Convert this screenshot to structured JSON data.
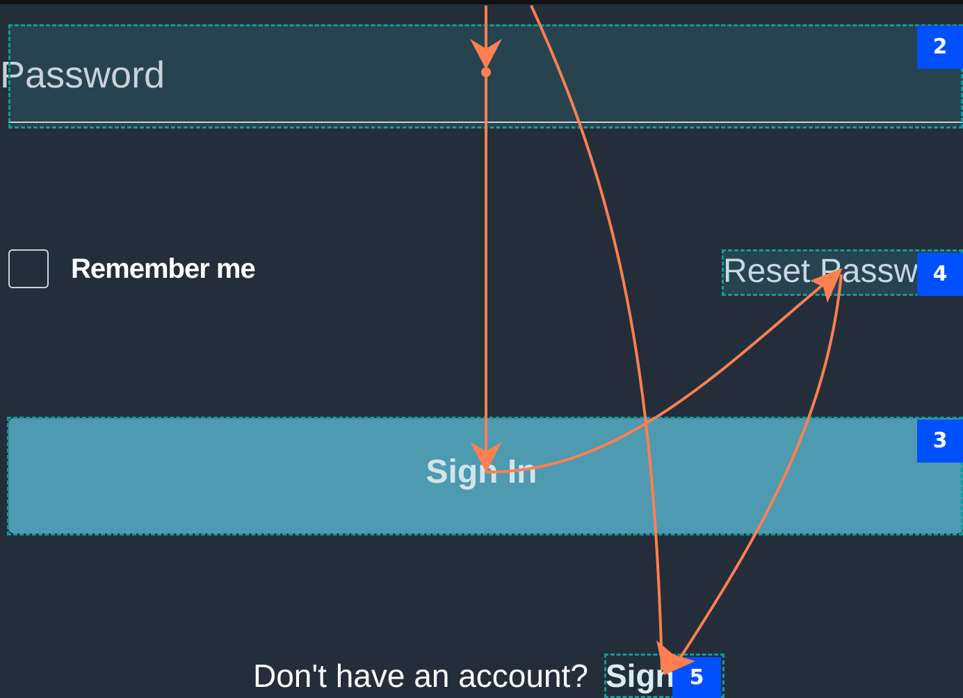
{
  "form": {
    "password": {
      "placeholder": "Password",
      "badge": "2"
    },
    "remember": {
      "label": "Remember me",
      "checked": false
    },
    "reset": {
      "label": "Reset Password",
      "badge": "4"
    },
    "signin": {
      "label": "Sign In",
      "badge": "3"
    },
    "signup": {
      "prompt": "Don't have an account?",
      "label": "Sign Up",
      "badge": "5"
    }
  },
  "colors": {
    "background": "#232e3a",
    "field_background": "#27434f",
    "button_background": "#4d9ab1",
    "badge": "#0050ff",
    "annotation_outline": "#15999a",
    "flow_arrow": "#ff7f50"
  }
}
